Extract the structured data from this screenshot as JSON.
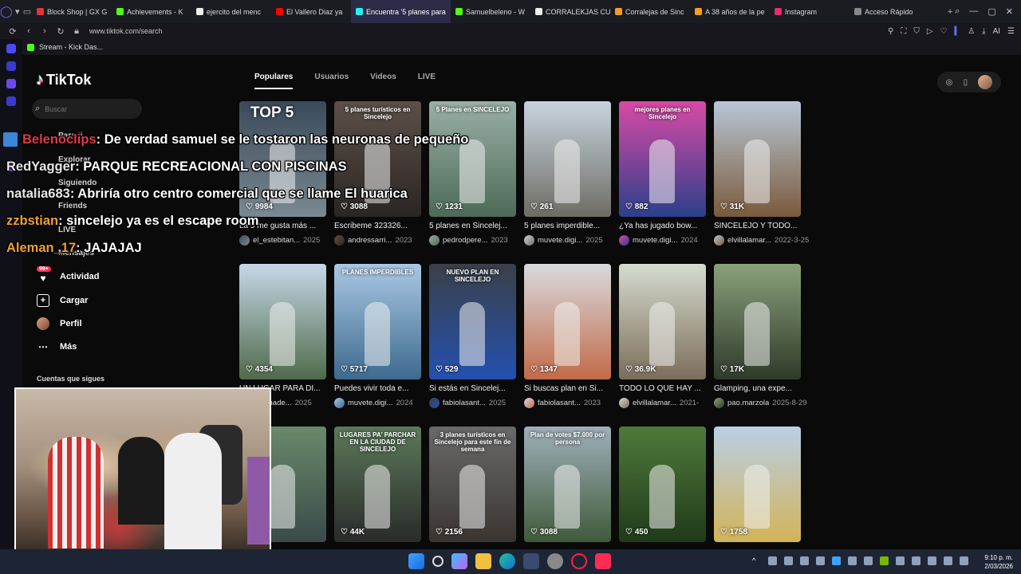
{
  "browser": {
    "tabs": [
      {
        "label": "Block Shop | GX G",
        "color": "#e0343f"
      },
      {
        "label": "Achievements - K",
        "color": "#53fc18"
      },
      {
        "label": "ejercito del menc",
        "color": "#eeeeee"
      },
      {
        "label": "El Vallero Diaz ya",
        "color": "#ff0000"
      },
      {
        "label": "Encuentra '5 planes para",
        "color": "#25f4ee"
      },
      {
        "label": "Samuelbeleno - W",
        "color": "#53fc18"
      },
      {
        "label": "CORRALEKJAS CU",
        "color": "#eeeeee"
      },
      {
        "label": "Corralejas de Sinc",
        "color": "#f0a020"
      },
      {
        "label": "A 38 años de la pe",
        "color": "#f0a020"
      },
      {
        "label": "Instagram",
        "color": "#e1306c"
      }
    ],
    "quick_access": "Acceso Rápido",
    "url": "www.tiktok.com/search",
    "bookmark": "Stream - Kick Das..."
  },
  "tiktok": {
    "logo": "TikTok",
    "search_placeholder": "Buscar",
    "nav": {
      "para_ti": "Para ti",
      "explorar": "Explorar",
      "siguiendo": "Siguiendo",
      "friends": "Friends",
      "live": "LIVE",
      "mensajes": "Mensajes",
      "actividad": "Actividad",
      "actividad_badge": "99+",
      "cargar": "Cargar",
      "perfil": "Perfil",
      "mas": "Más",
      "cuentas": "Cuentas que sigues"
    },
    "tabs": [
      "Populares",
      "Usuarios",
      "Videos",
      "LIVE"
    ],
    "videos": [
      {
        "likes": "9984",
        "caption": "La 5 me gusta más ...",
        "user": "el_estebitan...",
        "date": "2025",
        "overlay": "TOP 5",
        "c1": "#3a4a5a",
        "c2": "#7a8a92"
      },
      {
        "likes": "3088",
        "caption": "Escribeme 323326...",
        "user": "andressarri...",
        "date": "2023",
        "overlay": "5 planes turísticos en Sincelejo",
        "c1": "#5c5048",
        "c2": "#2a2624"
      },
      {
        "likes": "1231",
        "caption": "5 planes en Sincelej...",
        "user": "pedrodpere...",
        "date": "2023",
        "overlay": "5 Planes en SINCELEJO",
        "c1": "#9ab0a6",
        "c2": "#4d6a58"
      },
      {
        "likes": "261",
        "caption": "5 planes imperdible...",
        "user": "muvete.digi...",
        "date": "2025",
        "overlay": "",
        "c1": "#c7d4de",
        "c2": "#6e6c64"
      },
      {
        "likes": "882",
        "caption": "¿Ya has jugado bow...",
        "user": "muvete.digi...",
        "date": "2024",
        "overlay": "mejores planes en Sincelejo",
        "c1": "#d84aa6",
        "c2": "#2c3f8a"
      },
      {
        "likes": "31K",
        "caption": "SINCELEJO Y TODO...",
        "user": "elvillalamar...",
        "date": "2022-3-25",
        "overlay": "",
        "c1": "#b8c7d6",
        "c2": "#7a5a3c"
      },
      {
        "likes": "4354",
        "caption": "UN LUGAR PARA DI...",
        "user": "alilamade...",
        "date": "2025",
        "overlay": "",
        "c1": "#c6d8e8",
        "c2": "#4f6a4a"
      },
      {
        "likes": "5717",
        "caption": "Puedes vivir toda e...",
        "user": "muvete.digi...",
        "date": "2024",
        "overlay": "PLANES IMPERDIBLES",
        "c1": "#aac8e4",
        "c2": "#3d6a8e"
      },
      {
        "likes": "529",
        "caption": "Si estás en Sincelej...",
        "user": "fabiolasant...",
        "date": "2025",
        "overlay": "NUEVO PLAN EN SINCELEJO",
        "c1": "#3a4048",
        "c2": "#2450b0"
      },
      {
        "likes": "1347",
        "caption": "Si buscas plan en Si...",
        "user": "fabiolasant...",
        "date": "2023",
        "overlay": "",
        "c1": "#d8dade",
        "c2": "#c26a48"
      },
      {
        "likes": "36.9K",
        "caption": "TODO LO QUE HAY ...",
        "user": "elvillalamar...",
        "date": "2021-",
        "overlay": "",
        "c1": "#d6dccf",
        "c2": "#7b6d5a"
      },
      {
        "likes": "17K",
        "caption": "Glamping, una expe...",
        "user": "pao.marzola",
        "date": "2025-8-29",
        "overlay": "",
        "c1": "#8aa07a",
        "c2": "#2f3a2a"
      },
      {
        "likes": "37",
        "caption": "",
        "user": "",
        "date": "",
        "overlay": "",
        "c1": "#6a8a6a",
        "c2": "#3a4a4a"
      },
      {
        "likes": "44K",
        "caption": "",
        "user": "",
        "date": "",
        "overlay": "LUGARES PA' PARCHAR EN LA CIUDAD DE SINCELEJO",
        "c1": "#5c7a5a",
        "c2": "#2a2a2a"
      },
      {
        "likes": "2156",
        "caption": "",
        "user": "",
        "date": "",
        "overlay": "3 planes turísticos en Sincelejo para este fin de semana",
        "c1": "#6a6a6a",
        "c2": "#3a3430"
      },
      {
        "likes": "3088",
        "caption": "",
        "user": "",
        "date": "",
        "overlay": "Plan de votes $7.000 por persona",
        "c1": "#9fb0ba",
        "c2": "#3f5a3a"
      },
      {
        "likes": "450",
        "caption": "",
        "user": "",
        "date": "",
        "overlay": "",
        "c1": "#4f7a3a",
        "c2": "#1f3a1a"
      },
      {
        "likes": "1758",
        "caption": "",
        "user": "",
        "date": "",
        "overlay": "",
        "c1": "#b9cfe6",
        "c2": "#d2b458"
      }
    ]
  },
  "chat": [
    {
      "user": "Belenoclips",
      "color": "#e03a4a",
      "msg": ": De verdad samuel se le tostaron las neuronas de pequeño"
    },
    {
      "user": "RedYagger",
      "color": "#e8e8e8",
      "msg": ": PARQUE RECREACIONAL CON PISCINAS"
    },
    {
      "user": "natalia683",
      "color": "#e8e8e8",
      "msg": ": Abriría otro centro comercial que se llame El huarica"
    },
    {
      "user": "zzbstian",
      "color": "#f0a030",
      "msg": ": sincelejo ya es el escape room"
    },
    {
      "user": "Aleman_17",
      "color": "#f0a030",
      "msg": ": JAJAJAJ"
    }
  ],
  "taskbar": {
    "time": "9:10 p. m.",
    "date": "2/03/2026"
  }
}
